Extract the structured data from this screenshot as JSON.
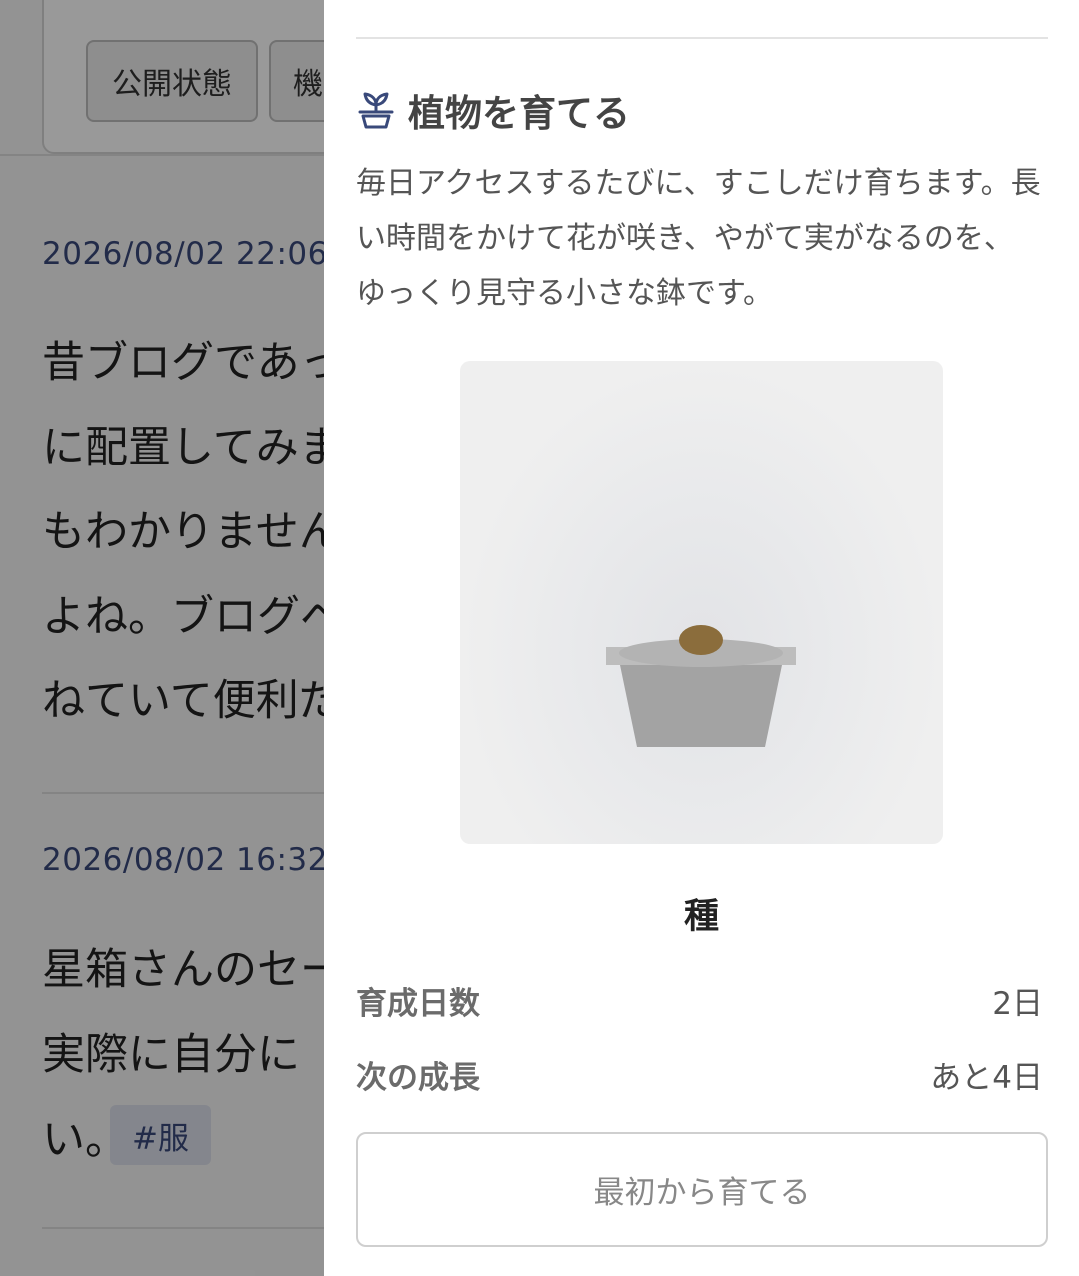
{
  "background": {
    "chips": [
      "公開状態",
      "機"
    ],
    "posts": [
      {
        "date": "2026/08/02 22:06",
        "lines": [
          "昔ブログであっ",
          "に配置してみま",
          "もわかりません",
          "よね。ブログペ",
          "ねていて便利だ"
        ]
      },
      {
        "date": "2026/08/02 16:32",
        "lines": [
          "星箱さんのセー",
          "実際に自分に",
          "い。"
        ],
        "tag": "#服"
      }
    ]
  },
  "drawer": {
    "title": "植物を育てる",
    "icon": "plant-pot-icon",
    "description_lines": [
      "毎日アクセスするたびに、すこしだけ育ちます。長",
      "い時間をかけて花が咲き、やがて実がなるのを、",
      "ゆっくり見守る小さな鉢です。"
    ],
    "stage_name": "種",
    "stats": [
      {
        "label": "育成日数",
        "value": "2日"
      },
      {
        "label": "次の成長",
        "value": "あと4日"
      }
    ],
    "reset_label": "最初から育てる",
    "colors": {
      "icon": "#39497a",
      "pot": "#a5a5a5",
      "seed": "#8b6d3c"
    }
  }
}
